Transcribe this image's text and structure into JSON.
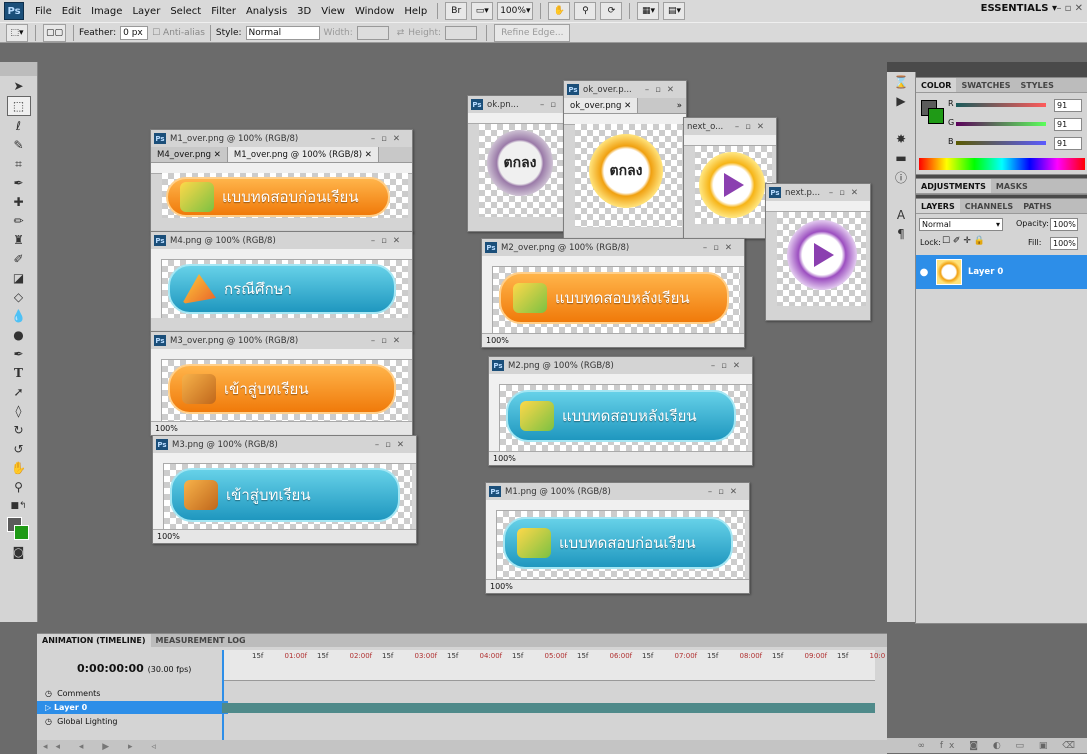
{
  "app": {
    "logo": "Ps"
  },
  "menu": [
    "File",
    "Edit",
    "Image",
    "Layer",
    "Select",
    "Filter",
    "Analysis",
    "3D",
    "View",
    "Window",
    "Help"
  ],
  "appbar": {
    "zoom": "100%",
    "workspace": "ESSENTIALS ▾"
  },
  "options": {
    "feather_label": "Feather:",
    "feather_value": "0 px",
    "antialias_label": "Anti-alias",
    "style_label": "Style:",
    "style_value": "Normal",
    "width_label": "Width:",
    "height_label": "Height:",
    "refine_edge": "Refine Edge..."
  },
  "docs": {
    "m1over": {
      "title": "M1_over.png @ 100% (RGB/8)",
      "tab1": "M4_over.png",
      "tab2": "M1_over.png @ 100% (RGB/8)",
      "text": "แบบทดสอบก่อนเรียน"
    },
    "m4": {
      "title": "M4.png @ 100% (RGB/8)",
      "text": "กรณีศึกษา"
    },
    "m3over": {
      "title": "M3_over.png @ 100% (RGB/8)",
      "text": "เข้าสู่บทเรียน",
      "zoom": "100%"
    },
    "m3": {
      "title": "M3.png @ 100% (RGB/8)",
      "text": "เข้าสู่บทเรียน",
      "zoom": "100%"
    },
    "okpn": {
      "title": "ok.pn...",
      "text": "ตกลง"
    },
    "okover": {
      "title": "ok_over.p...",
      "tab": "ok_over.png",
      "text": "ตกลง"
    },
    "nexto": {
      "title": "next_o..."
    },
    "nextp": {
      "title": "next.p..."
    },
    "m2over": {
      "title": "M2_over.png @ 100% (RGB/8)",
      "text": "แบบทดสอบหลังเรียน",
      "zoom": "100%"
    },
    "m2": {
      "title": "M2.png @ 100% (RGB/8)",
      "text": "แบบทดสอบหลังเรียน",
      "zoom": "100%"
    },
    "m1": {
      "title": "M1.png @ 100% (RGB/8)",
      "text": "แบบทดสอบก่อนเรียน",
      "zoom": "100%"
    }
  },
  "color_panel": {
    "tabs": [
      "COLOR",
      "SWATCHES",
      "STYLES"
    ],
    "r_label": "R",
    "g_label": "G",
    "b_label": "B",
    "r": "91",
    "g": "91",
    "b": "91"
  },
  "adjust_panel": {
    "tabs": [
      "ADJUSTMENTS",
      "MASKS"
    ]
  },
  "layers_panel": {
    "tabs": [
      "LAYERS",
      "CHANNELS",
      "PATHS"
    ],
    "blend": "Normal",
    "opacity_label": "Opacity:",
    "opacity": "100%",
    "lock_label": "Lock:",
    "fill_label": "Fill:",
    "fill": "100%",
    "layer_name": "Layer 0"
  },
  "timeline": {
    "tabs": [
      "ANIMATION (TIMELINE)",
      "MEASUREMENT LOG"
    ],
    "timecode": "0:00:00:00",
    "fps": "(30.00 fps)",
    "ticks": [
      "15f",
      "01:00f",
      "15f",
      "02:00f",
      "15f",
      "03:00f",
      "15f",
      "04:00f",
      "15f",
      "05:00f",
      "15f",
      "06:00f",
      "15f",
      "07:00f",
      "15f",
      "08:00f",
      "15f",
      "09:00f",
      "15f",
      "10:0"
    ],
    "rows": {
      "comments": "Comments",
      "layer": "Layer 0",
      "global": "Global Lighting"
    }
  },
  "colors": {
    "orange": "#f28a1c",
    "blue": "#2aa8cf",
    "selection": "#2d8ee8",
    "purple": "#8b3fb0"
  }
}
